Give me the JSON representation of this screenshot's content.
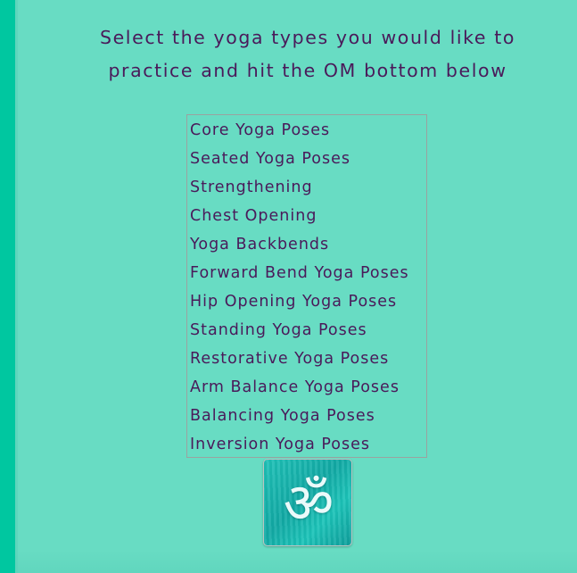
{
  "instructions": {
    "line1": "Select the yoga types you would like to",
    "line2": "practice and hit the OM bottom below"
  },
  "yoga_types": {
    "options": [
      "Core Yoga Poses",
      "Seated Yoga Poses",
      "Strengthening",
      "Chest Opening",
      "Yoga Backbends",
      "Forward Bend Yoga Poses",
      "Hip Opening Yoga Poses",
      "Standing Yoga Poses",
      "Restorative Yoga Poses",
      "Arm Balance Yoga Poses",
      "Balancing Yoga Poses",
      "Inversion Yoga Poses"
    ]
  },
  "om_button": {
    "glyph": "ॐ",
    "icon": "om-icon"
  },
  "colors": {
    "background": "#68dcc3",
    "left_bar": "#00c7a0",
    "text": "#4a1a5a",
    "button": "#1fc2b8"
  }
}
